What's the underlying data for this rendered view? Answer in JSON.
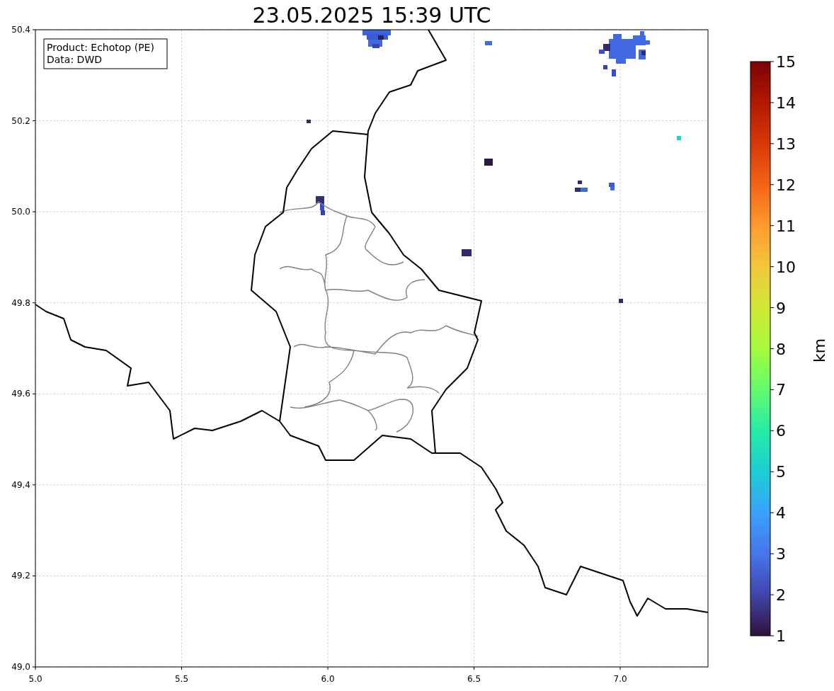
{
  "title": "23.05.2025 15:39 UTC",
  "info_box": {
    "lines": [
      "Product: Echotop (PE)",
      "Data: DWD"
    ]
  },
  "x_ticks": [
    "5.0",
    "5.5",
    "6.0",
    "6.5",
    "7.0"
  ],
  "y_ticks": [
    "50.4",
    "50.2",
    "50.0",
    "49.8",
    "49.6",
    "49.4",
    "49.2",
    "49.0"
  ],
  "colorbar": {
    "label": "km",
    "ticks": [
      "15",
      "14",
      "13",
      "12",
      "11",
      "10",
      "9",
      "8",
      "7",
      "6",
      "5",
      "4",
      "3",
      "2",
      "1"
    ]
  }
}
